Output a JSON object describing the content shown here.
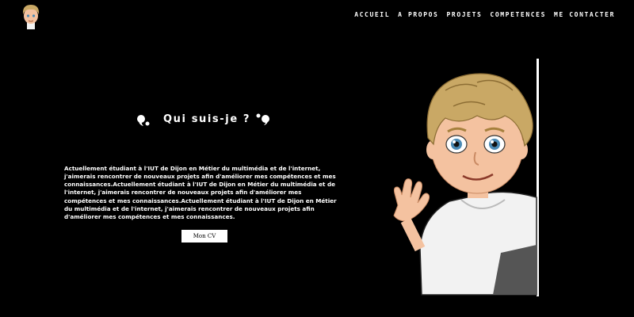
{
  "nav": {
    "items": [
      "ACCUEIL",
      "A PROPOS",
      "PROJETS",
      "COMPETENCES",
      "ME CONTACTER"
    ]
  },
  "about": {
    "title": "Qui suis-je ?",
    "paragraph": "Actuellement étudiant à l'IUT de Dijon en Métier du multimédia et de l'internet, j'aimerais rencontrer de nouveaux projets afin d'améliorer mes compétences et mes connaissances.Actuellement étudiant à l'IUT de Dijon en Métier du multimédia et de l'internet, j'aimerais rencontrer de nouveaux projets afin d'améliorer mes compétences et mes connaissances.Actuellement étudiant à l'IUT de Dijon en Métier du multimédia et de l'internet, j'aimerais rencontrer de nouveaux projets afin d'améliorer mes compétences et mes connaissances.",
    "cv_button": "Mon CV"
  },
  "colors": {
    "background": "#000000",
    "text": "#ffffff",
    "hair": "#c9a865",
    "skin": "#f4c2a0",
    "hoodie": "#f2f2f2"
  },
  "icons": {
    "avatar": "avatar-icon",
    "quote_open": "quote-open-icon",
    "quote_close": "quote-close-icon"
  }
}
